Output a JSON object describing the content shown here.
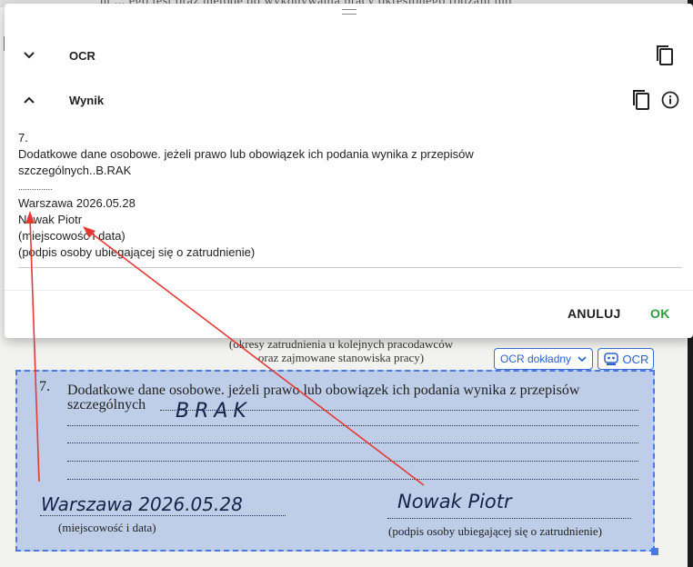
{
  "background_document": {
    "top_text_fragment": "nt ... ego test oraz metodę do wykonywania pracy określonego rodzaju lub",
    "caption_line1": "(okresy zatrudnienia u kolejnych pracodawców",
    "caption_line2": "oraz zajmowane stanowiska pracy)",
    "ocr_mode_select": "OCR dokładny",
    "ocr_button": "OCR",
    "item_number": "7.",
    "line1": "Dodatkowe dane osobowe. jeżeli prawo lub obowiązek ich podania wynika z przepisów",
    "line2": "szczególnych",
    "handwritten_brak": "BRAK",
    "handwritten_place_date": "Warszawa 2026.05.28",
    "handwritten_name": "Nowak Piotr",
    "place_date_caption": "(miejscowość i data)",
    "signature_caption": "(podpis osoby ubiegającej się o zatrudnienie)"
  },
  "dialog": {
    "section_ocr_title": "OCR",
    "section_result_title": "Wynik",
    "result_lines": [
      "7.",
      "Dodatkowe dane osobowe. jeżeli prawo lub obowiązek ich podania wynika z przepisów",
      "szczególnych..B.RAK",
      "...............",
      "Warszawa 2026.05.28",
      "Nowak Piotr",
      "(miejscowość i data)",
      "(podpis osoby ubiegającej się o zatrudnienie)"
    ],
    "cancel_label": "ANULUJ",
    "ok_label": "OK"
  },
  "colors": {
    "accent_green": "#2e9e3e",
    "annotation_red": "#e53935",
    "selection_blue": "#4a7ae0"
  },
  "icons": [
    "chevron-down-icon",
    "chevron-up-icon",
    "copy-icon",
    "info-icon",
    "robot-icon",
    "drag-handle-icon",
    "cursor-icon"
  ]
}
